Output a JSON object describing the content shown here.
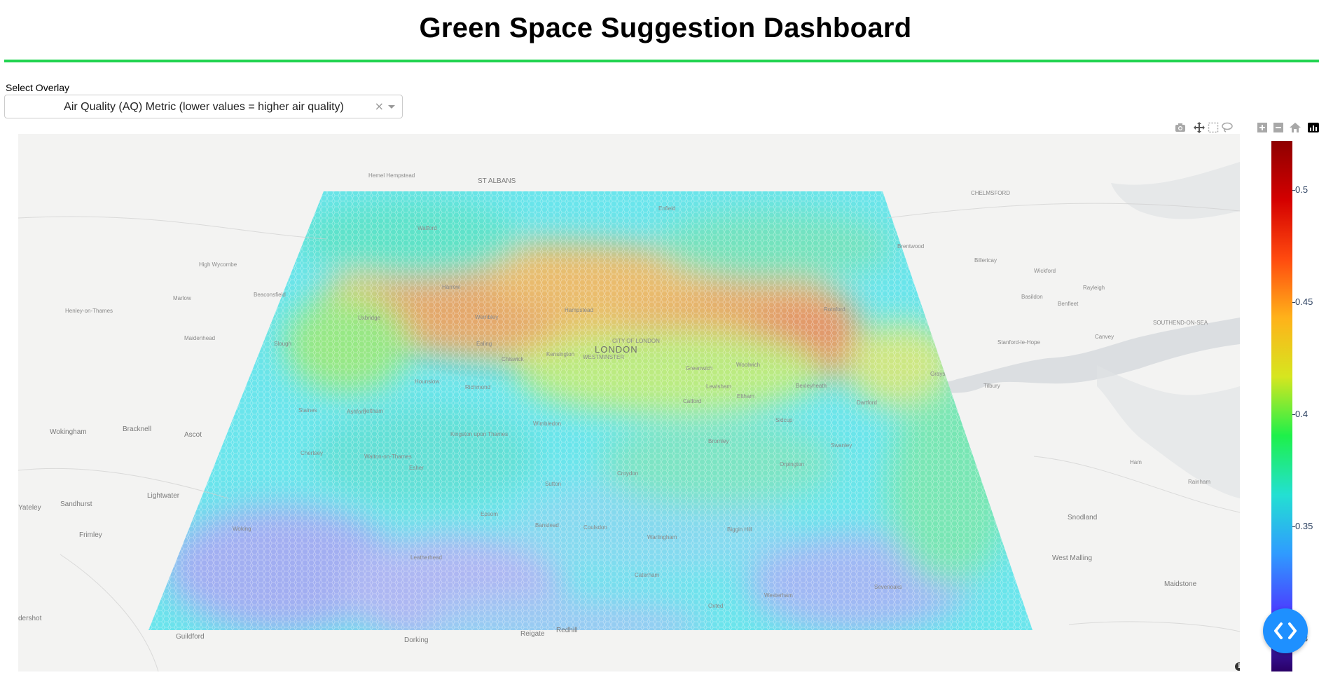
{
  "header": {
    "title": "Green Space Suggestion Dashboard"
  },
  "overlay_control": {
    "label": "Select Overlay",
    "selected": "Air Quality (AQ) Metric (lower values = higher air quality)"
  },
  "modebar": {
    "icons": [
      "camera-icon",
      "pan-icon",
      "box-select-icon",
      "lasso-icon",
      "zoom-in-icon",
      "zoom-out-icon",
      "home-icon",
      "plotly-logo"
    ]
  },
  "map": {
    "place_labels": [
      {
        "name": "ST ALBANS",
        "cls": "big"
      },
      {
        "name": "CHELMSFORD",
        "cls": ""
      },
      {
        "name": "CITY OF LONDON",
        "cls": ""
      },
      {
        "name": "LONDON",
        "cls": "lon"
      },
      {
        "name": "WESTMINSTER",
        "cls": ""
      },
      {
        "name": "Wokingham",
        "cls": "big"
      },
      {
        "name": "Bracknell",
        "cls": "big"
      },
      {
        "name": "Ascot",
        "cls": "big"
      },
      {
        "name": "Sandhurst",
        "cls": "big"
      },
      {
        "name": "Lightwater",
        "cls": "big"
      },
      {
        "name": "Frimley",
        "cls": "big"
      },
      {
        "name": "Yateley",
        "cls": "big"
      },
      {
        "name": "dershot",
        "cls": "big"
      },
      {
        "name": "Guildford",
        "cls": "big"
      },
      {
        "name": "Dorking",
        "cls": "big"
      },
      {
        "name": "Reigate",
        "cls": "big"
      },
      {
        "name": "Redhill",
        "cls": "big"
      },
      {
        "name": "Tilbury",
        "cls": ""
      },
      {
        "name": "Grays",
        "cls": ""
      },
      {
        "name": "SOUTHEND-ON-SEA",
        "cls": ""
      },
      {
        "name": "Maidstone",
        "cls": "big"
      },
      {
        "name": "West Malling",
        "cls": "big"
      },
      {
        "name": "Snodland",
        "cls": "big"
      },
      {
        "name": "Rainham",
        "cls": ""
      },
      {
        "name": "Ham",
        "cls": ""
      },
      {
        "name": "Sevenoaks",
        "cls": ""
      },
      {
        "name": "Westerham",
        "cls": ""
      },
      {
        "name": "Oxted",
        "cls": ""
      },
      {
        "name": "Caterham",
        "cls": ""
      },
      {
        "name": "Woking",
        "cls": ""
      },
      {
        "name": "Leatherhead",
        "cls": ""
      },
      {
        "name": "Epsom",
        "cls": ""
      },
      {
        "name": "Sutton",
        "cls": ""
      },
      {
        "name": "Croydon",
        "cls": ""
      },
      {
        "name": "Bromley",
        "cls": ""
      },
      {
        "name": "Orpington",
        "cls": ""
      },
      {
        "name": "Dartford",
        "cls": ""
      },
      {
        "name": "Greenwich",
        "cls": ""
      },
      {
        "name": "Richmond",
        "cls": ""
      },
      {
        "name": "Ealing",
        "cls": ""
      },
      {
        "name": "Slough",
        "cls": ""
      },
      {
        "name": "Maidenhead",
        "cls": ""
      },
      {
        "name": "Chertsey",
        "cls": ""
      },
      {
        "name": "Wimbledon",
        "cls": ""
      },
      {
        "name": "Kingston upon Thames",
        "cls": ""
      },
      {
        "name": "Walton-on-Thames",
        "cls": ""
      },
      {
        "name": "Esher",
        "cls": ""
      },
      {
        "name": "Banstead",
        "cls": ""
      },
      {
        "name": "Coulsdon",
        "cls": ""
      },
      {
        "name": "Warlingham",
        "cls": ""
      },
      {
        "name": "Biggin Hill",
        "cls": ""
      },
      {
        "name": "Swanley",
        "cls": ""
      },
      {
        "name": "Sidcup",
        "cls": ""
      },
      {
        "name": "Bexleyheath",
        "cls": ""
      },
      {
        "name": "Lewisham",
        "cls": ""
      },
      {
        "name": "Catford",
        "cls": ""
      },
      {
        "name": "Eltham",
        "cls": ""
      },
      {
        "name": "Woolwich",
        "cls": ""
      },
      {
        "name": "Hounslow",
        "cls": ""
      },
      {
        "name": "Feltham",
        "cls": ""
      },
      {
        "name": "Ashford",
        "cls": ""
      },
      {
        "name": "Staines",
        "cls": ""
      },
      {
        "name": "Chiswick",
        "cls": ""
      },
      {
        "name": "Kensington",
        "cls": ""
      },
      {
        "name": "Hampstead",
        "cls": ""
      },
      {
        "name": "Wembley",
        "cls": ""
      },
      {
        "name": "Harrow",
        "cls": ""
      },
      {
        "name": "Uxbridge",
        "cls": ""
      },
      {
        "name": "Marlow",
        "cls": ""
      },
      {
        "name": "High Wycombe",
        "cls": ""
      },
      {
        "name": "Beaconsfield",
        "cls": ""
      },
      {
        "name": "Henley-on-Thames",
        "cls": ""
      },
      {
        "name": "Hemel Hempstead",
        "cls": ""
      },
      {
        "name": "Watford",
        "cls": ""
      },
      {
        "name": "Enfield",
        "cls": ""
      },
      {
        "name": "Romford",
        "cls": ""
      },
      {
        "name": "Basildon",
        "cls": ""
      },
      {
        "name": "Billericay",
        "cls": ""
      },
      {
        "name": "Brentwood",
        "cls": ""
      },
      {
        "name": "Stanford-le-Hope",
        "cls": ""
      },
      {
        "name": "Canvey",
        "cls": ""
      },
      {
        "name": "Rayleigh",
        "cls": ""
      },
      {
        "name": "Wickford",
        "cls": ""
      },
      {
        "name": "Benfleet",
        "cls": ""
      }
    ]
  },
  "colorbar": {
    "ticks": [
      "0.5",
      "0.45",
      "0.4",
      "0.35",
      "0.3"
    ],
    "colorscale": [
      "#2a0066",
      "#4b3cff",
      "#2f9bff",
      "#23e0d2",
      "#1ef04a",
      "#d6e61f",
      "#ffb21a",
      "#ff4a0f",
      "#d40000",
      "#8e0000"
    ]
  },
  "fab": {
    "icon": "code-chevrons-icon"
  }
}
